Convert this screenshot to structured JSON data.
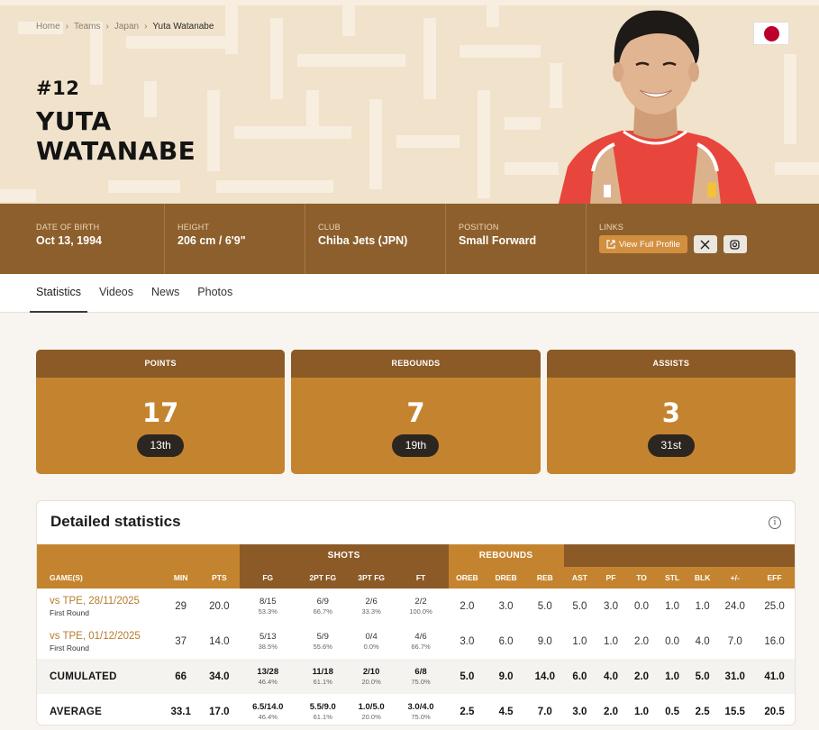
{
  "breadcrumb": {
    "home": "Home",
    "teams": "Teams",
    "country": "Japan",
    "current": "Yuta Watanabe"
  },
  "player": {
    "jersey": "#12",
    "first_name": "YUTA",
    "last_name": "WATANABE"
  },
  "info": {
    "dob_label": "DATE OF BIRTH",
    "dob": "Oct 13, 1994",
    "height_label": "HEIGHT",
    "height": "206 cm / 6'9\"",
    "club_label": "CLUB",
    "club": "Chiba Jets (JPN)",
    "position_label": "POSITION",
    "position": "Small Forward",
    "links_label": "LINKS",
    "profile_btn": "View Full Profile"
  },
  "tabs": [
    "Statistics",
    "Videos",
    "News",
    "Photos"
  ],
  "summary": [
    {
      "label": "POINTS",
      "value": "17",
      "rank": "13th"
    },
    {
      "label": "REBOUNDS",
      "value": "7",
      "rank": "19th"
    },
    {
      "label": "ASSISTS",
      "value": "3",
      "rank": "31st"
    }
  ],
  "detailed": {
    "title": "Detailed statistics",
    "groups": {
      "shots": "SHOTS",
      "rebounds": "REBOUNDS"
    },
    "headers": [
      "GAME(S)",
      "MIN",
      "PTS",
      "FG",
      "2PT FG",
      "3PT FG",
      "FT",
      "OREB",
      "DREB",
      "REB",
      "AST",
      "PF",
      "TO",
      "STL",
      "BLK",
      "+/-",
      "EFF"
    ],
    "games": [
      {
        "game": "vs TPE, 28/11/2025",
        "round": "First Round",
        "min": "29",
        "pts": "20.0",
        "fg": "8/15",
        "fg_pct": "53.3%",
        "fg2": "6/9",
        "fg2_pct": "66.7%",
        "fg3": "2/6",
        "fg3_pct": "33.3%",
        "ft": "2/2",
        "ft_pct": "100.0%",
        "oreb": "2.0",
        "dreb": "3.0",
        "reb": "5.0",
        "ast": "5.0",
        "pf": "3.0",
        "to": "0.0",
        "stl": "1.0",
        "blk": "1.0",
        "pm": "24.0",
        "eff": "25.0"
      },
      {
        "game": "vs TPE, 01/12/2025",
        "round": "First Round",
        "min": "37",
        "pts": "14.0",
        "fg": "5/13",
        "fg_pct": "38.5%",
        "fg2": "5/9",
        "fg2_pct": "55.6%",
        "fg3": "0/4",
        "fg3_pct": "0.0%",
        "ft": "4/6",
        "ft_pct": "66.7%",
        "oreb": "3.0",
        "dreb": "6.0",
        "reb": "9.0",
        "ast": "1.0",
        "pf": "1.0",
        "to": "2.0",
        "stl": "0.0",
        "blk": "4.0",
        "pm": "7.0",
        "eff": "16.0"
      }
    ],
    "cumulated": {
      "label": "CUMULATED",
      "min": "66",
      "pts": "34.0",
      "fg": "13/28",
      "fg_pct": "46.4%",
      "fg2": "11/18",
      "fg2_pct": "61.1%",
      "fg3": "2/10",
      "fg3_pct": "20.0%",
      "ft": "6/8",
      "ft_pct": "75.0%",
      "oreb": "5.0",
      "dreb": "9.0",
      "reb": "14.0",
      "ast": "6.0",
      "pf": "4.0",
      "to": "2.0",
      "stl": "1.0",
      "blk": "5.0",
      "pm": "31.0",
      "eff": "41.0"
    },
    "average": {
      "label": "AVERAGE",
      "min": "33.1",
      "pts": "17.0",
      "fg": "6.5/14.0",
      "fg_pct": "46.4%",
      "fg2": "5.5/9.0",
      "fg2_pct": "61.1%",
      "fg3": "1.0/5.0",
      "fg3_pct": "20.0%",
      "ft": "3.0/4.0",
      "ft_pct": "75.0%",
      "oreb": "2.5",
      "dreb": "4.5",
      "reb": "7.0",
      "ast": "3.0",
      "pf": "2.0",
      "to": "1.0",
      "stl": "0.5",
      "blk": "2.5",
      "pm": "15.5",
      "eff": "20.5"
    }
  },
  "colors": {
    "accent": "#c4842f",
    "dark_accent": "#8b5a26",
    "info_bar": "#8d5f2c",
    "hero_bg": "#f1e2cb",
    "link": "#b57c2c"
  },
  "icons": [
    "chevron-right-icon",
    "external-link-icon",
    "x-social-icon",
    "instagram-icon",
    "info-icon",
    "japan-flag-icon"
  ]
}
